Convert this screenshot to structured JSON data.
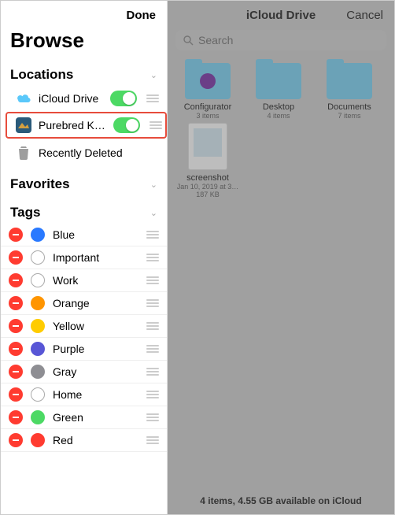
{
  "sidebar": {
    "done": "Done",
    "title": "Browse",
    "sections": {
      "locations": {
        "title": "Locations",
        "items": [
          {
            "label": "iCloud Drive",
            "toggle": true
          },
          {
            "label": "Purebred Ke...",
            "toggle": true
          },
          {
            "label": "Recently Deleted"
          }
        ]
      },
      "favorites": {
        "title": "Favorites"
      },
      "tags": {
        "title": "Tags",
        "items": [
          {
            "label": "Blue",
            "color": "#2979ff",
            "filled": true
          },
          {
            "label": "Important",
            "color": "",
            "filled": false
          },
          {
            "label": "Work",
            "color": "",
            "filled": false
          },
          {
            "label": "Orange",
            "color": "#ff9500",
            "filled": true
          },
          {
            "label": "Yellow",
            "color": "#ffcc00",
            "filled": true
          },
          {
            "label": "Purple",
            "color": "#5856d6",
            "filled": true
          },
          {
            "label": "Gray",
            "color": "#8e8e93",
            "filled": true
          },
          {
            "label": "Home",
            "color": "",
            "filled": false
          },
          {
            "label": "Green",
            "color": "#4cd964",
            "filled": true
          },
          {
            "label": "Red",
            "color": "#ff3b30",
            "filled": true
          }
        ]
      }
    }
  },
  "main": {
    "title": "iCloud Drive",
    "cancel": "Cancel",
    "search_placeholder": "Search",
    "folders": [
      {
        "name": "Configurator",
        "meta": "3 items",
        "badge": "#7b3fa0"
      },
      {
        "name": "Desktop",
        "meta": "4 items",
        "badge": ""
      },
      {
        "name": "Documents",
        "meta": "7 items",
        "badge": ""
      }
    ],
    "files": [
      {
        "name": "screenshot",
        "meta1": "Jan 10, 2019 at 3…",
        "meta2": "187 KB"
      }
    ],
    "footer": "4 items, 4.55 GB available on iCloud"
  }
}
